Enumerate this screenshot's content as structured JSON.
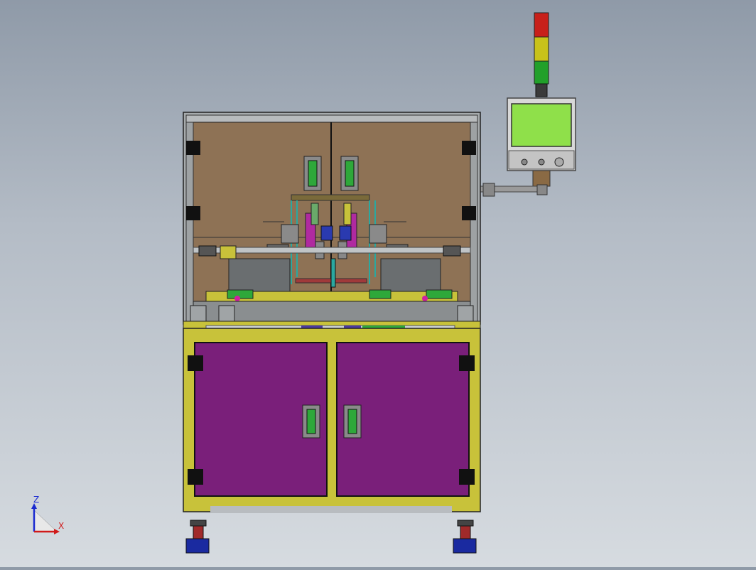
{
  "triad": {
    "z_label": "Z",
    "x_label": "X"
  },
  "colors": {
    "background_top": "#8f9aa8",
    "background_bottom": "#d6dbe0",
    "frame": "#9fa3a6",
    "interior_panel": "#8e7255",
    "base_yellow": "#c8c23a",
    "cabinet_door": "#7a1f7a",
    "handle_green": "#2ea83a",
    "hmi_screen": "#8fe04a",
    "tower_red": "#c8201a",
    "tower_yellow": "#c8c21a",
    "tower_green": "#22a02a",
    "foot_blue": "#1a2aa0",
    "mechanism_teal": "#2aa8a0",
    "mechanism_magenta": "#b02aa0",
    "mechanism_blue": "#2a3ab0"
  },
  "icons": {
    "axis_triad": "xyz-axis-triad-icon"
  }
}
